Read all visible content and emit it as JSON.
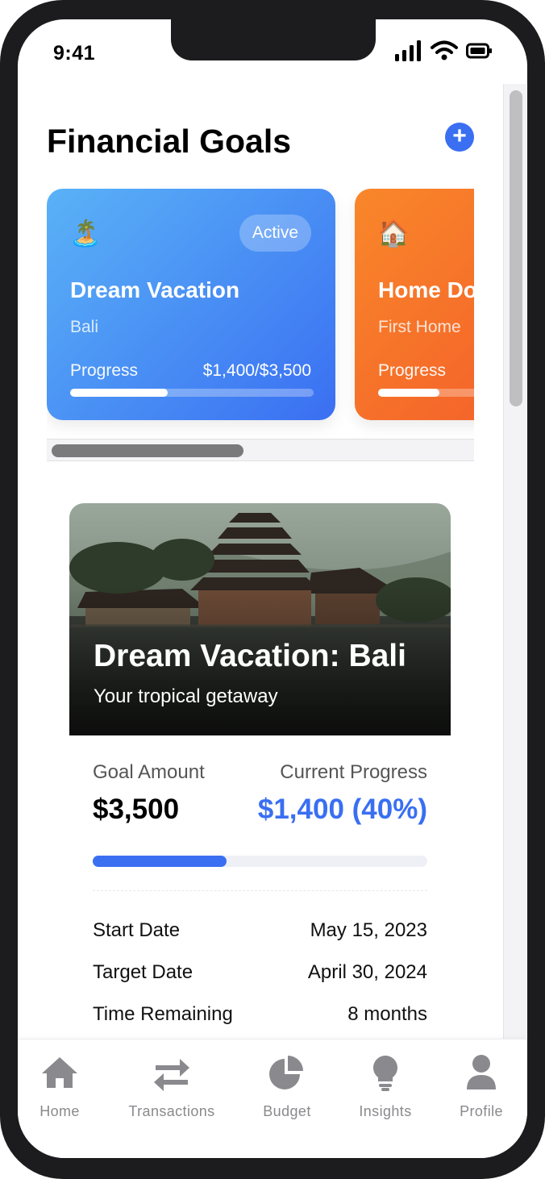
{
  "status_bar": {
    "time": "9:41"
  },
  "header": {
    "title": "Financial Goals",
    "add_icon": "plus-icon"
  },
  "goals": [
    {
      "emoji": "🏝️",
      "badge": "Active",
      "title": "Dream Vacation",
      "subtitle": "Bali",
      "progress_label": "Progress",
      "progress_value": "$1,400/$3,500",
      "progress_fraction": 0.4,
      "color_from": "#5ab2f7",
      "color_to": "#3a6ff2"
    },
    {
      "emoji": "🏠",
      "title": "Home Do",
      "subtitle": "First Home",
      "progress_label": "Progress",
      "progress_fraction": 0.25,
      "color_from": "#f9872a",
      "color_to": "#f2552a"
    }
  ],
  "detail": {
    "hero_title": "Dream Vacation: Bali",
    "hero_subtitle": "Your tropical getaway",
    "goal_amount_label": "Goal Amount",
    "goal_amount": "$3,500",
    "current_progress_label": "Current Progress",
    "current_progress": "$1,400 (40%)",
    "progress_fraction": 0.4,
    "rows": [
      {
        "label": "Start Date",
        "value": "May 15, 2023"
      },
      {
        "label": "Target Date",
        "value": "April 30, 2024"
      },
      {
        "label": "Time Remaining",
        "value": "8 months"
      }
    ]
  },
  "tabbar": {
    "items": [
      {
        "label": "Home",
        "icon": "home-icon"
      },
      {
        "label": "Transactions",
        "icon": "transfer-arrows-icon"
      },
      {
        "label": "Budget",
        "icon": "pie-chart-icon"
      },
      {
        "label": "Insights",
        "icon": "lightbulb-icon"
      },
      {
        "label": "Profile",
        "icon": "user-icon"
      }
    ]
  },
  "colors": {
    "accent": "#3a6ff2",
    "tab_inactive": "#8a8a8e"
  }
}
